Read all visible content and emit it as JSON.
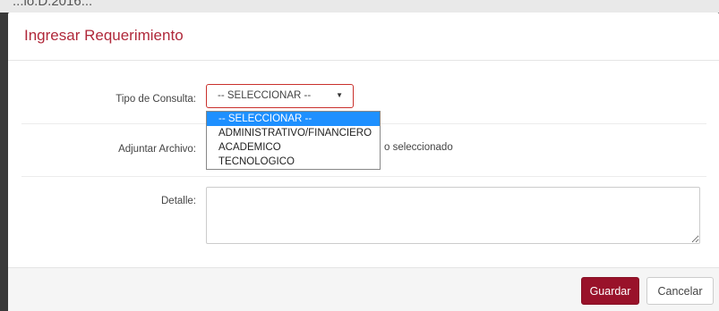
{
  "background": {
    "partial_text": "...io.D.2016..."
  },
  "modal": {
    "title": "Ingresar Requerimiento",
    "fields": {
      "tipo_label": "Tipo de Consulta:",
      "tipo_value": "-- SELECCIONAR --",
      "adjuntar_label": "Adjuntar Archivo:",
      "adjuntar_status": "o seleccionado",
      "detalle_label": "Detalle:",
      "detalle_value": ""
    },
    "dropdown_options": [
      "-- SELECCIONAR --",
      "ADMINISTRATIVO/FINANCIERO",
      "ACADEMICO",
      "TECNOLOGICO"
    ],
    "footer": {
      "guardar_label": "Guardar",
      "cancelar_label": "Cancelar"
    }
  },
  "colors": {
    "title": "#b0283a",
    "primary_button": "#99122a",
    "highlight": "#1e90ff"
  }
}
